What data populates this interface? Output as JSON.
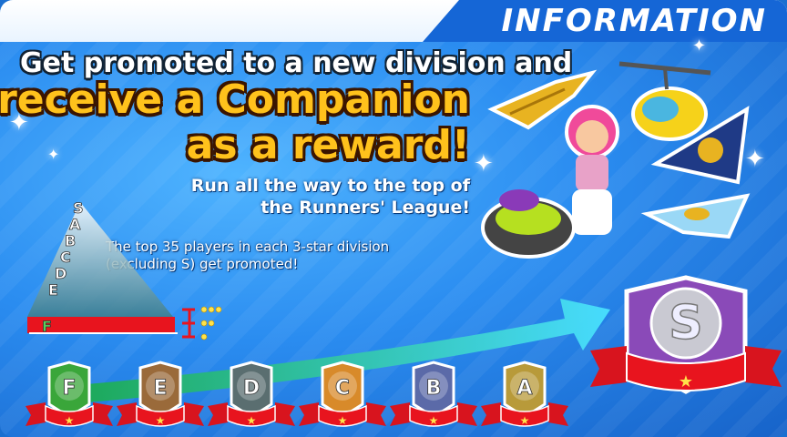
{
  "header": {
    "title": "INFORMATION"
  },
  "headline": {
    "line1": "Get promoted to a new division and",
    "line2": "receive a Companion",
    "line3": "as a reward!"
  },
  "subtitle": {
    "line1": "Run all the way to the top of",
    "line2": "the Runners' League!"
  },
  "note": {
    "line1": "The top 35 players in each 3-star division",
    "line2": "(excluding S) get promoted!"
  },
  "pyramid_letters": [
    "S",
    "A",
    "B",
    "C",
    "D",
    "E",
    "F"
  ],
  "divisions": [
    {
      "letter": "F",
      "color": "#3aa63a"
    },
    {
      "letter": "E",
      "color": "#9a6a3a"
    },
    {
      "letter": "D",
      "color": "#5a6e70"
    },
    {
      "letter": "C",
      "color": "#d88a2a"
    },
    {
      "letter": "B",
      "color": "#5b6aa8"
    },
    {
      "letter": "A",
      "color": "#b89a3a"
    }
  ],
  "top_division": {
    "letter": "S",
    "color": "#8a4ab8"
  },
  "colors": {
    "accent": "#ffc21c",
    "header": "#1566d6",
    "ribbon": "#d8141e"
  }
}
